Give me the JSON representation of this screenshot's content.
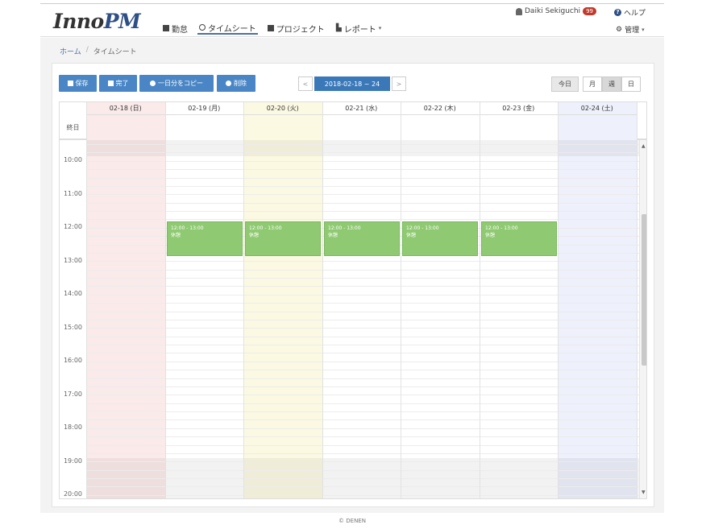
{
  "app": {
    "logo_part1": "Inno",
    "logo_part2": "PM"
  },
  "nav": [
    {
      "label": "勤怠",
      "icon": "calendar-icon",
      "active": false
    },
    {
      "label": "タイムシート",
      "icon": "clock-icon",
      "active": true
    },
    {
      "label": "プロジェクト",
      "icon": "folder-icon",
      "active": false
    },
    {
      "label": "レポート",
      "icon": "chart-icon",
      "active": false,
      "has_dropdown": true
    }
  ],
  "user": {
    "name": "Daiki Sekiguchi",
    "badge": "99"
  },
  "help_label": "ヘルプ",
  "admin_label": "管理",
  "breadcrumb": {
    "home": "ホーム",
    "separator": "/",
    "current": "タイムシート"
  },
  "toolbar": {
    "save_label": "保存",
    "done_label": "完了",
    "copy_label": "一日分をコピー",
    "delete_label": "削除"
  },
  "date_nav": {
    "prev": "<",
    "range": "2018-02-18 ~ 24",
    "next": ">"
  },
  "view_buttons": {
    "today": "今日",
    "month": "月",
    "week": "週",
    "day": "日",
    "active": "week"
  },
  "calendar": {
    "allday_label": "終日",
    "days": [
      {
        "label": "02-18 (日)",
        "bg": "#fbeaea"
      },
      {
        "label": "02-19 (月)",
        "bg": "#ffffff"
      },
      {
        "label": "02-20 (火)",
        "bg": "#fcf9e3"
      },
      {
        "label": "02-21 (水)",
        "bg": "#ffffff"
      },
      {
        "label": "02-22 (木)",
        "bg": "#ffffff"
      },
      {
        "label": "02-23 (金)",
        "bg": "#ffffff"
      },
      {
        "label": "02-24 (土)",
        "bg": "#eef0fb"
      }
    ],
    "times": [
      "10:00",
      "11:00",
      "12:00",
      "13:00",
      "14:00",
      "15:00",
      "16:00",
      "17:00",
      "18:00",
      "19:00",
      "20:00"
    ],
    "events": [
      {
        "day": 1,
        "time": "12:00 - 13:00",
        "title": "休憩"
      },
      {
        "day": 2,
        "time": "12:00 - 13:00",
        "title": "休憩"
      },
      {
        "day": 3,
        "time": "12:00 - 13:00",
        "title": "休憩"
      },
      {
        "day": 4,
        "time": "12:00 - 13:00",
        "title": "休憩"
      },
      {
        "day": 5,
        "time": "12:00 - 13:00",
        "title": "休憩"
      }
    ],
    "event_color": "#8fca72"
  },
  "footer": "© DENEN"
}
